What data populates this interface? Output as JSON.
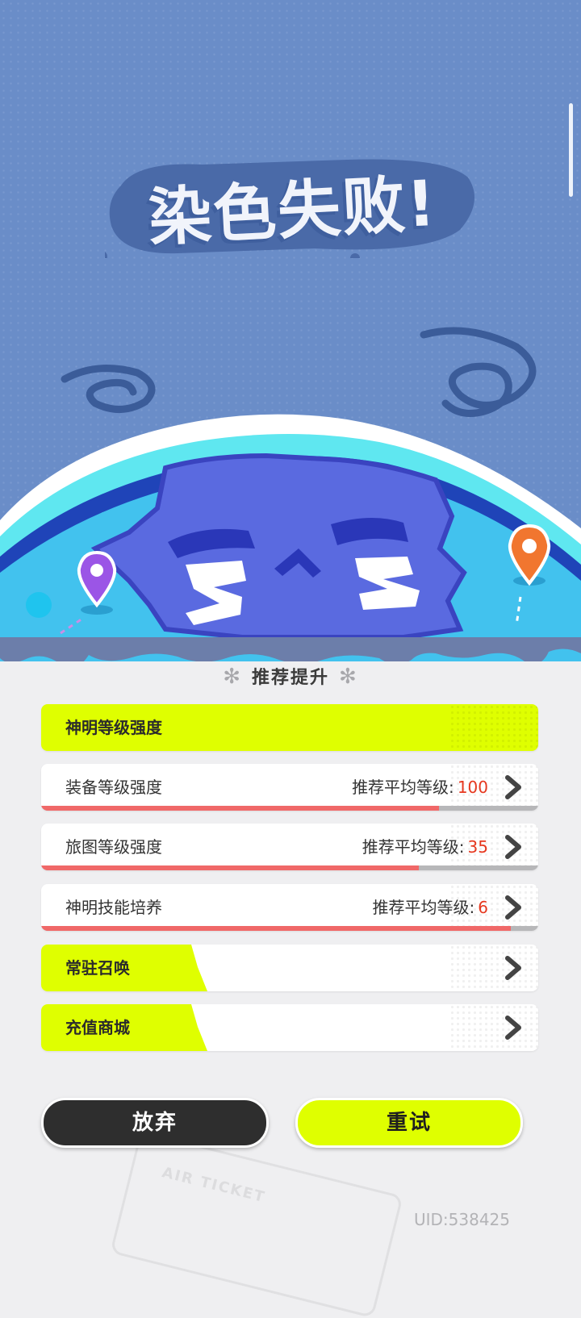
{
  "header": {
    "title": "染色失败!"
  },
  "recommend": {
    "section_title": "推荐提升",
    "rows": [
      {
        "label": "神明等级强度"
      },
      {
        "label": "装备等级强度",
        "rec_label": "推荐平均等级:",
        "rec_value": "100",
        "progress": 0.8
      },
      {
        "label": "旅图等级强度",
        "rec_label": "推荐平均等级:",
        "rec_value": "35",
        "progress": 0.76
      },
      {
        "label": "神明技能培养",
        "rec_label": "推荐平均等级:",
        "rec_value": "6",
        "progress": 0.945
      },
      {
        "label": "常驻召唤"
      },
      {
        "label": "充值商城"
      }
    ]
  },
  "buttons": {
    "give_up": "放弃",
    "retry": "重试"
  },
  "footer": {
    "uid": "UID:538425",
    "ticket_text": "AIR TICKET"
  },
  "colors": {
    "accent_yellow": "#DFFF00",
    "progress_red": "#F06868",
    "value_red": "#E6381F",
    "bg_blue": "#6A8DC8"
  }
}
